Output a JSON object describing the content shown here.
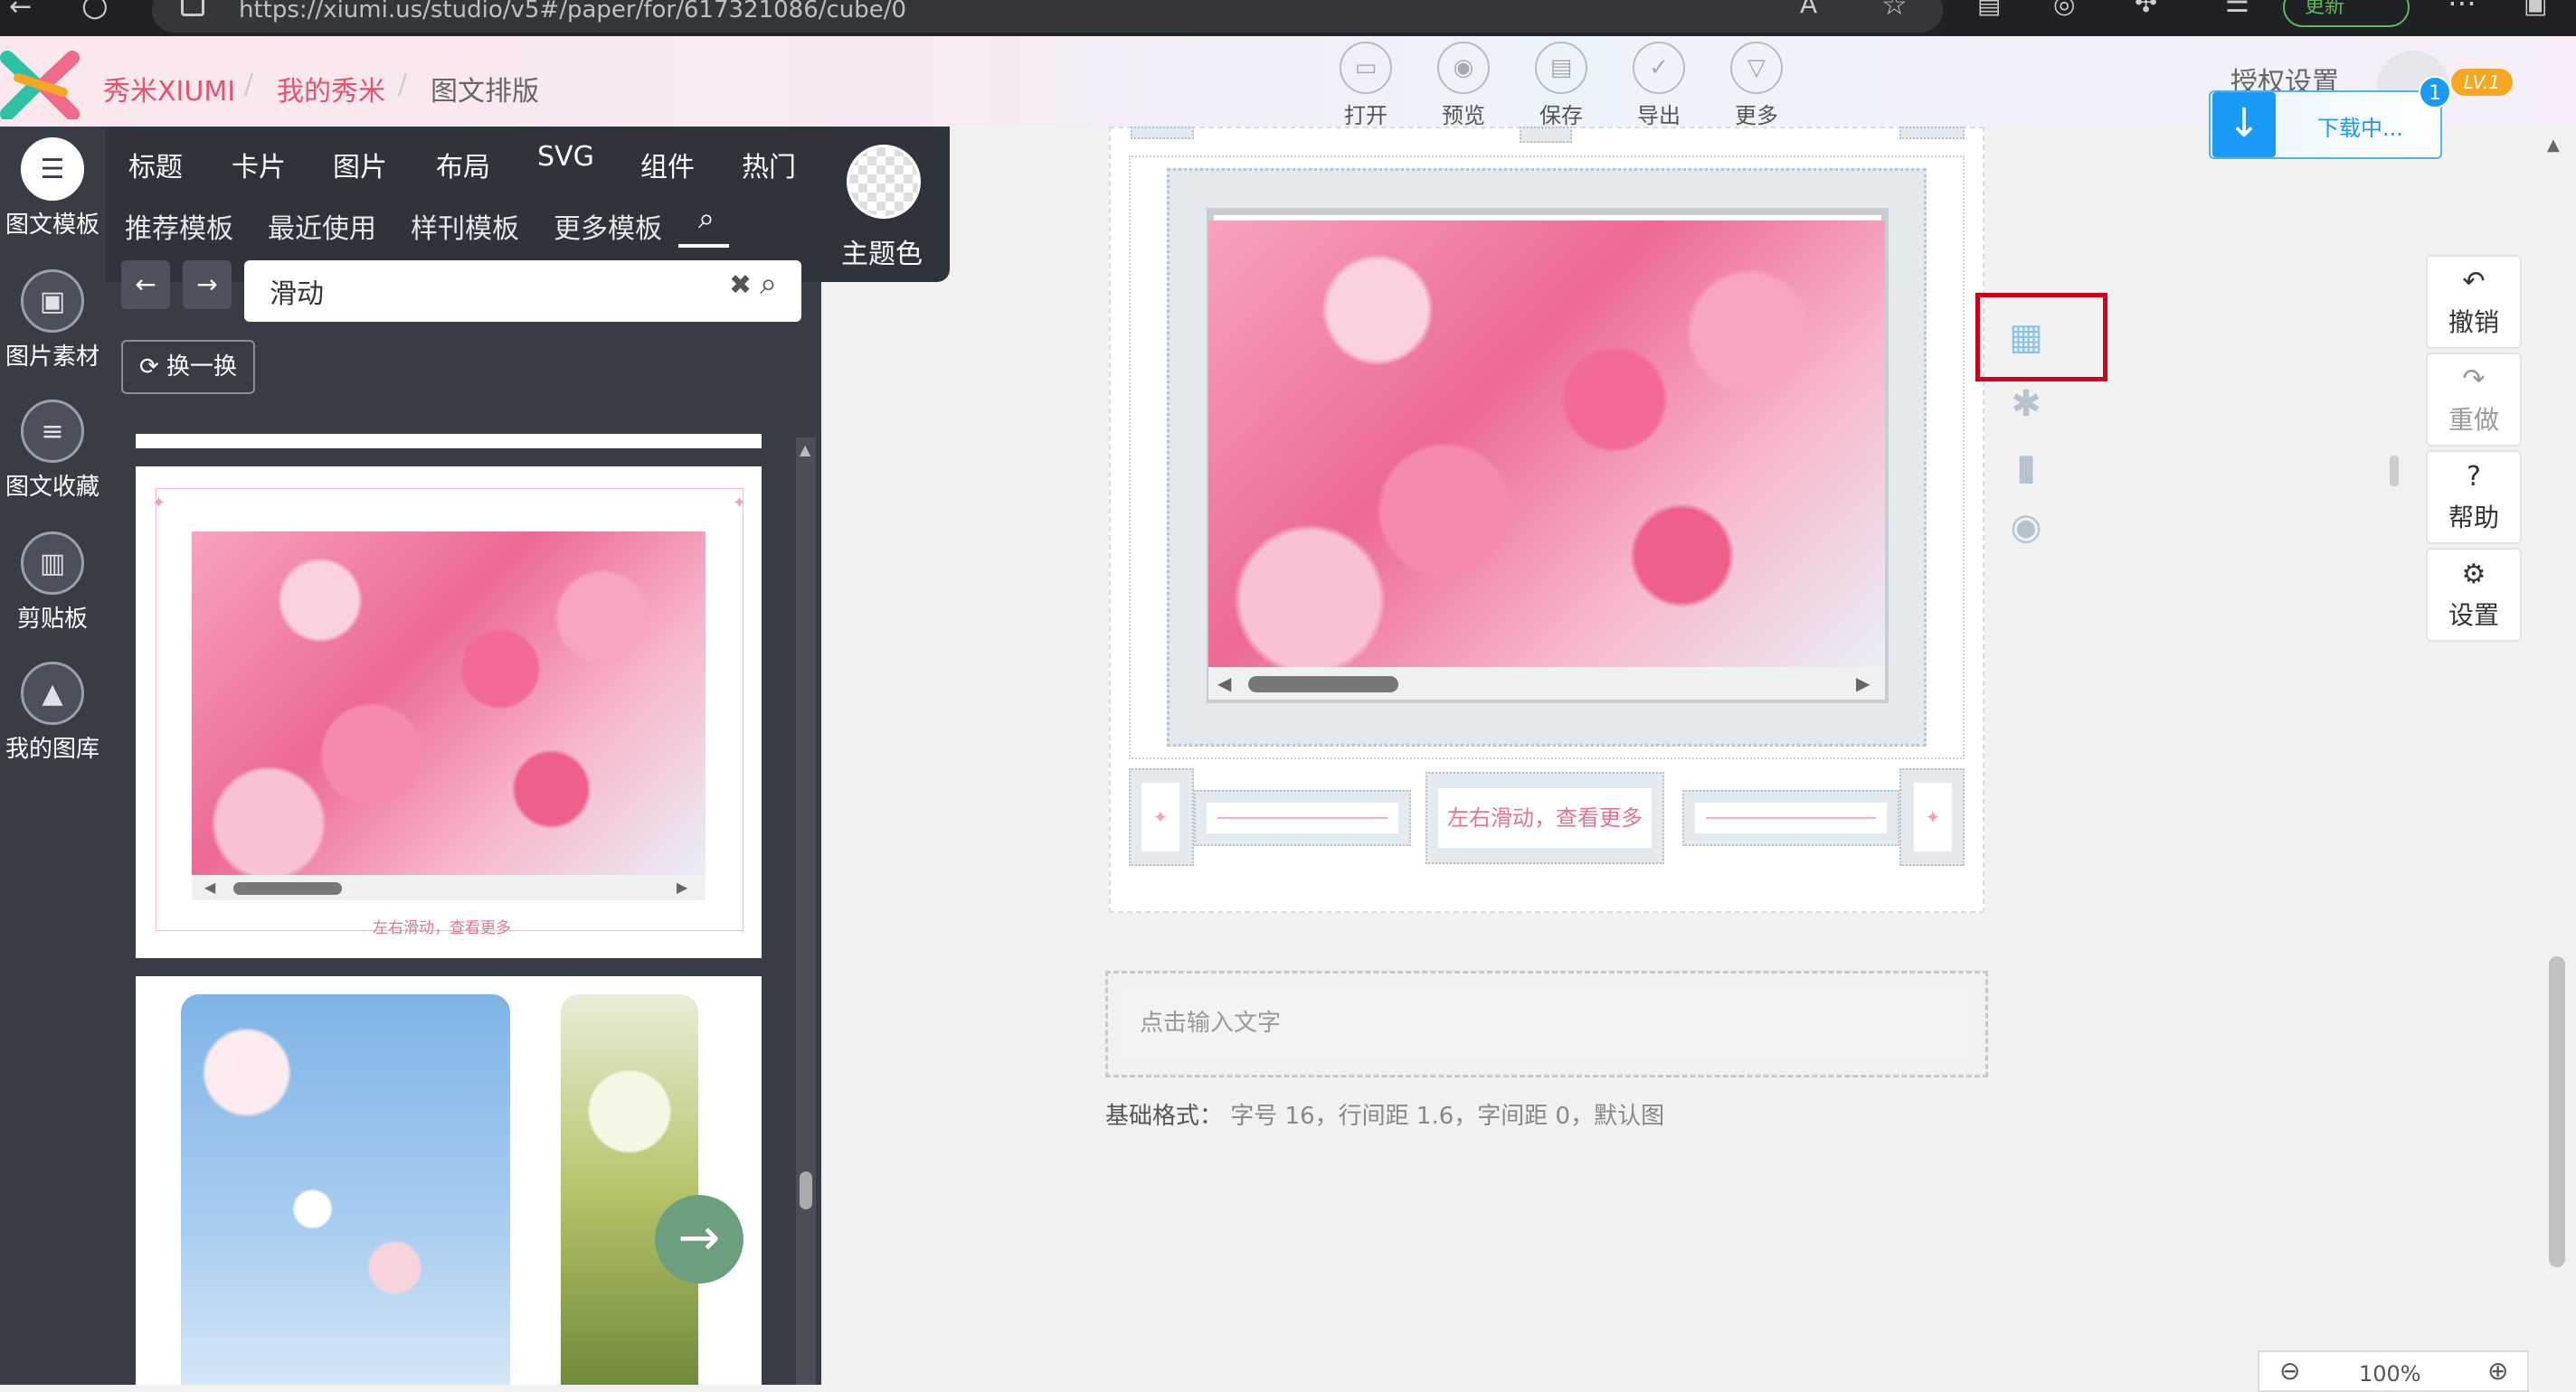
{
  "browser": {
    "url": "https://xiumi.us/studio/v5#/paper/for/617321086/cube/0",
    "update_label": "更新"
  },
  "header": {
    "brand": "秀米XIUMI",
    "my_xiumi": "我的秀米",
    "section": "图文排版",
    "separator": "/",
    "auth_settings": "授权设置",
    "level": "LV.1",
    "toolbar": [
      {
        "label": "打开",
        "icon": "folder-icon"
      },
      {
        "label": "预览",
        "icon": "preview-icon"
      },
      {
        "label": "保存",
        "icon": "save-icon"
      },
      {
        "label": "导出",
        "icon": "export-icon"
      },
      {
        "label": "更多",
        "icon": "more-icon"
      }
    ]
  },
  "download": {
    "label": "下载中...",
    "badge": "1"
  },
  "left_rail": [
    {
      "label": "图文模板",
      "icon": "list-icon",
      "active": true
    },
    {
      "label": "图片素材",
      "icon": "image-icon"
    },
    {
      "label": "图文收藏",
      "icon": "bookmark-icon"
    },
    {
      "label": "剪贴板",
      "icon": "clipboard-icon"
    },
    {
      "label": "我的图库",
      "icon": "gallery-icon"
    }
  ],
  "category_tabs": [
    "标题",
    "卡片",
    "图片",
    "布局",
    "SVG",
    "组件",
    "热门"
  ],
  "template_tabs": [
    "推荐模板",
    "最近使用",
    "样刊模板",
    "更多模板"
  ],
  "search": {
    "value": "滑动"
  },
  "swap_label": "换一换",
  "theme_label": "主题色",
  "cards": {
    "caption": "左右滑动，查看更多"
  },
  "canvas": {
    "caption": "左右滑动，查看更多"
  },
  "right_tools": [
    {
      "label": "撤销",
      "icon": "undo-icon"
    },
    {
      "label": "重做",
      "icon": "redo-icon"
    },
    {
      "label": "帮助",
      "icon": "help-icon"
    },
    {
      "label": "设置",
      "icon": "gear-icon"
    }
  ],
  "editor": {
    "text_placeholder": "点击输入文字",
    "base_format_label": "基础格式",
    "base_format_value": "字号 16，行间距 1.6，字间距 0，默认图"
  },
  "zoom": "100%",
  "colors": {
    "accent_red": "#d0021b",
    "brand_pink": "#e8526a",
    "download_blue": "#1a9af7",
    "panel_dark": "#383c45"
  }
}
